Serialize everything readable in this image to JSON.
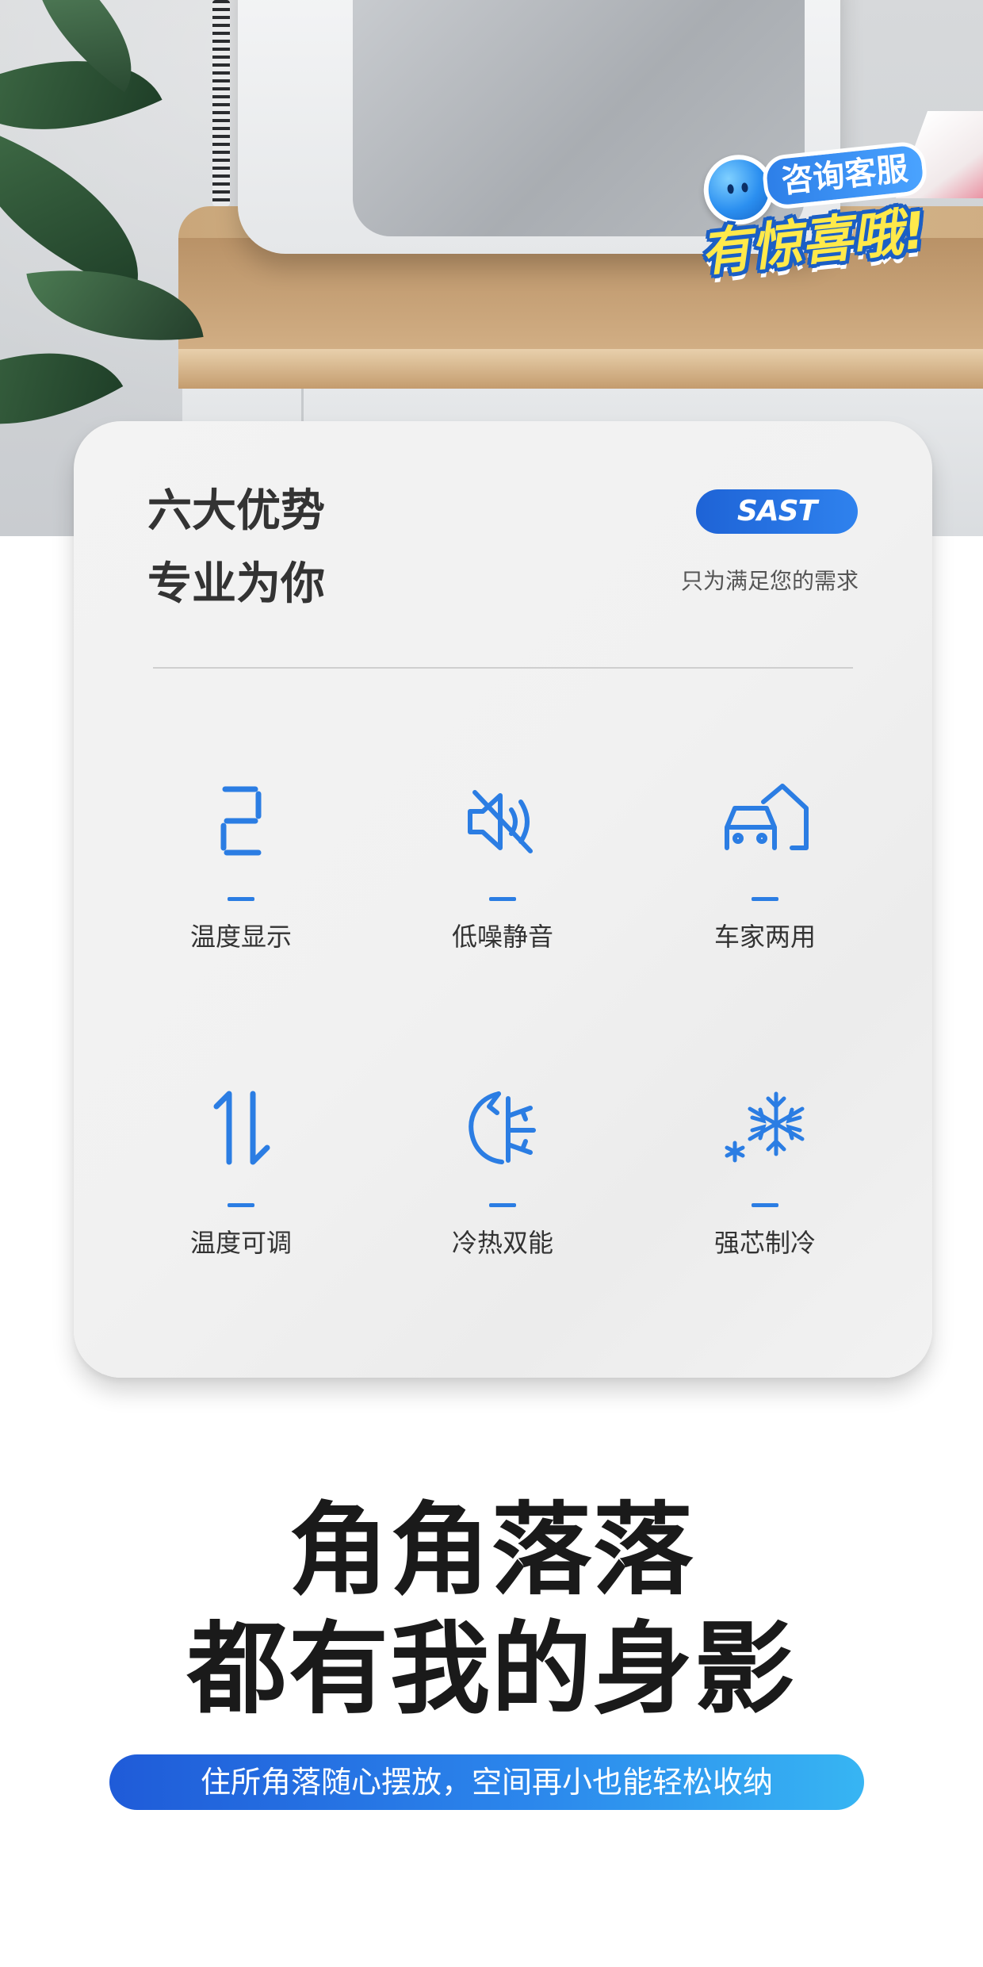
{
  "promo_badge": {
    "top_text": "咨询客服",
    "main_text": "有惊喜哦!"
  },
  "card": {
    "title_line1": "六大优势",
    "title_line2": "专业为你",
    "brand": "SAST",
    "subtitle": "只为满足您的需求",
    "features": [
      {
        "label": "温度显示",
        "icon": "digit-display-icon"
      },
      {
        "label": "低噪静音",
        "icon": "mute-speaker-icon"
      },
      {
        "label": "车家两用",
        "icon": "car-home-icon"
      },
      {
        "label": "温度可调",
        "icon": "up-down-arrows-icon"
      },
      {
        "label": "冷热双能",
        "icon": "hot-cold-icon"
      },
      {
        "label": "强芯制冷",
        "icon": "snowflake-icon"
      }
    ]
  },
  "headline": {
    "line1": "角角落落",
    "line2": "都有我的身影",
    "tagline": "住所角落随心摆放，空间再小也能轻松收纳"
  },
  "colors": {
    "accent": "#2b7de3",
    "card_bg": "#f1f1f1",
    "badge_yellow": "#ffe94a"
  }
}
